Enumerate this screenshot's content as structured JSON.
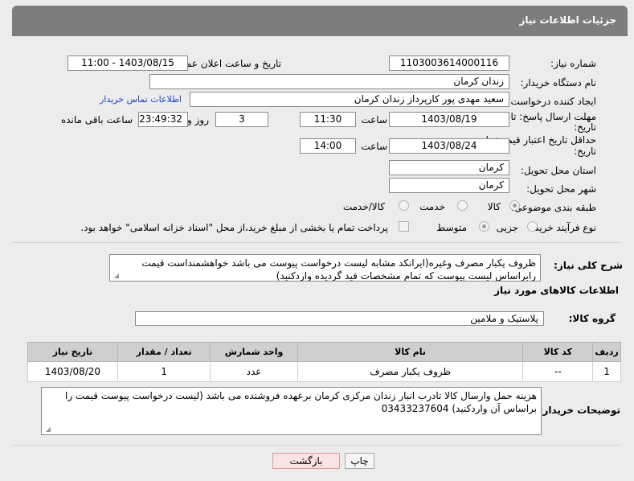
{
  "header": {
    "title": "جزئیات اطلاعات نیاز"
  },
  "labels": {
    "need_number": "شماره نیاز:",
    "announce_datetime": "تاریخ و ساعت اعلان عمومی:",
    "buyer_org": "نام دستگاه خریدار:",
    "requester": "ایجاد کننده درخواست:",
    "contact_link": "اطلاعات تماس خریدار",
    "deadline_line1": "مهلت ارسال پاسخ: تا",
    "deadline_line2": "تاریخ:",
    "hour": "ساعت",
    "days_and": "روز و",
    "remaining": "ساعت باقی مانده",
    "validity_line1": "حداقل تاریخ اعتبار قیمت: تا",
    "validity_line2": "تاریخ:",
    "province": "استان محل تحویل:",
    "city": "شهر محل تحویل:",
    "category": "طبقه بندی موضوعی:",
    "process_type": "نوع فرآیند خرید :",
    "description": "شرح کلی نیاز:",
    "goods_info": "اطلاعات کالاهای مورد نیاز",
    "goods_group": "گروه کالا:",
    "buyer_notes": "توضیحات خریدار:"
  },
  "fields": {
    "need_number": "1103003614000116",
    "announce_datetime": "1403/08/15 - 11:00",
    "buyer_org": "زندان کرمان",
    "requester": "سعید مهدی پور کارپرداز زندان کرمان",
    "deadline_date": "1403/08/19",
    "deadline_time": "11:30",
    "remaining_days": "3",
    "remaining_time": "23:49:32",
    "validity_date": "1403/08/24",
    "validity_time": "14:00",
    "province": "کرمان",
    "city": "کرمان",
    "description": "ظروف یکبار مصرف وغیره(ایرانکد مشابه لیست درخواست پیوست می باشد خواهشمنداست قیمت رابراساس لیست پیوست که تمام مشخصات قید گردیده واردکنید)",
    "goods_group": "پلاستیک و ملامین",
    "buyer_notes": "هزینه حمل وارسال کالا تادرب انبار زندان مرکزی کرمان برعهده فروشنده می باشد (لیست درخواست پیوست قیمت را براساس آن واردکنید) 03433237604"
  },
  "category_options": [
    {
      "label": "کالا",
      "selected": true
    },
    {
      "label": "خدمت",
      "selected": false
    },
    {
      "label": "کالا/خدمت",
      "selected": false
    }
  ],
  "process_options": [
    {
      "label": "جزیی",
      "selected": false
    },
    {
      "label": "متوسط",
      "selected": true
    }
  ],
  "payment_note": "پرداخت تمام یا بخشی از مبلغ خرید،از محل \"اسناد خزانه اسلامی\" خواهد بود.",
  "table": {
    "headers": [
      "ردیف",
      "کد کالا",
      "نام کالا",
      "واحد شمارش",
      "تعداد / مقدار",
      "تاریخ نیاز"
    ],
    "rows": [
      [
        "1",
        "--",
        "ظروف یکبار مصرف",
        "عدد",
        "1",
        "1403/08/20"
      ]
    ]
  },
  "buttons": {
    "print": "چاپ",
    "back": "بازگشت"
  }
}
